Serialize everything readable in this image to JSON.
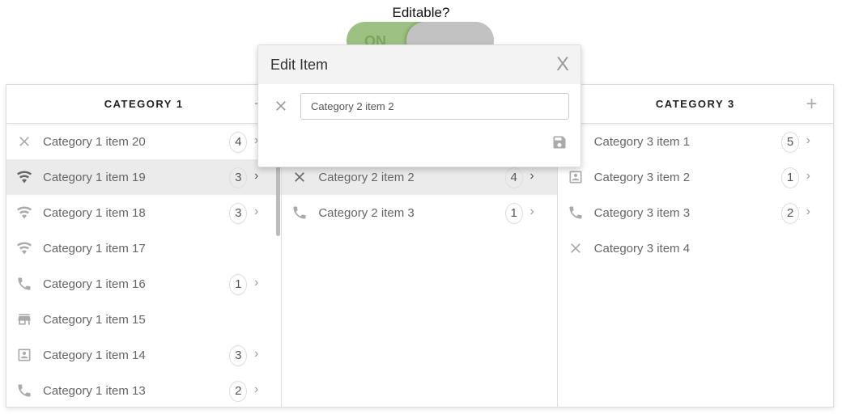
{
  "title": "Editable?",
  "toggle": {
    "label": "ON",
    "state": true,
    "color": "#9dc183"
  },
  "columns": [
    {
      "title": "CATEGORY 1",
      "add": "+",
      "items": [
        {
          "icon": "close",
          "label": "Category 1 item 20",
          "count": "4"
        },
        {
          "icon": "wifi",
          "label": "Category 1 item 19",
          "count": "3",
          "selected": true
        },
        {
          "icon": "wifi",
          "label": "Category 1 item 18",
          "count": "3"
        },
        {
          "icon": "wifi",
          "label": "Category 1 item 17"
        },
        {
          "icon": "phone",
          "label": "Category 1 item 16",
          "count": "1"
        },
        {
          "icon": "store",
          "label": "Category 1 item 15"
        },
        {
          "icon": "contact",
          "label": "Category 1 item 14",
          "count": "3"
        },
        {
          "icon": "phone",
          "label": "Category 1 item 13",
          "count": "2"
        }
      ]
    },
    {
      "title": "",
      "add": "",
      "items": [
        {
          "icon": "",
          "label": "",
          "hidden": true
        },
        {
          "icon": "close",
          "label": "Category 2 item 2",
          "count": "4",
          "selected": true
        },
        {
          "icon": "phone",
          "label": "Category 2 item 3",
          "count": "1"
        }
      ]
    },
    {
      "title": "CATEGORY 3",
      "add": "+",
      "items": [
        {
          "icon": "",
          "label": "Category 3 item 1",
          "count": "5"
        },
        {
          "icon": "contact",
          "label": "Category 3 item 2",
          "count": "1"
        },
        {
          "icon": "phone",
          "label": "Category 3 item 3",
          "count": "2"
        },
        {
          "icon": "close",
          "label": "Category 3 item 4"
        }
      ]
    }
  ],
  "modal": {
    "title": "Edit Item",
    "close": "X",
    "value": "Category 2 item 2"
  }
}
